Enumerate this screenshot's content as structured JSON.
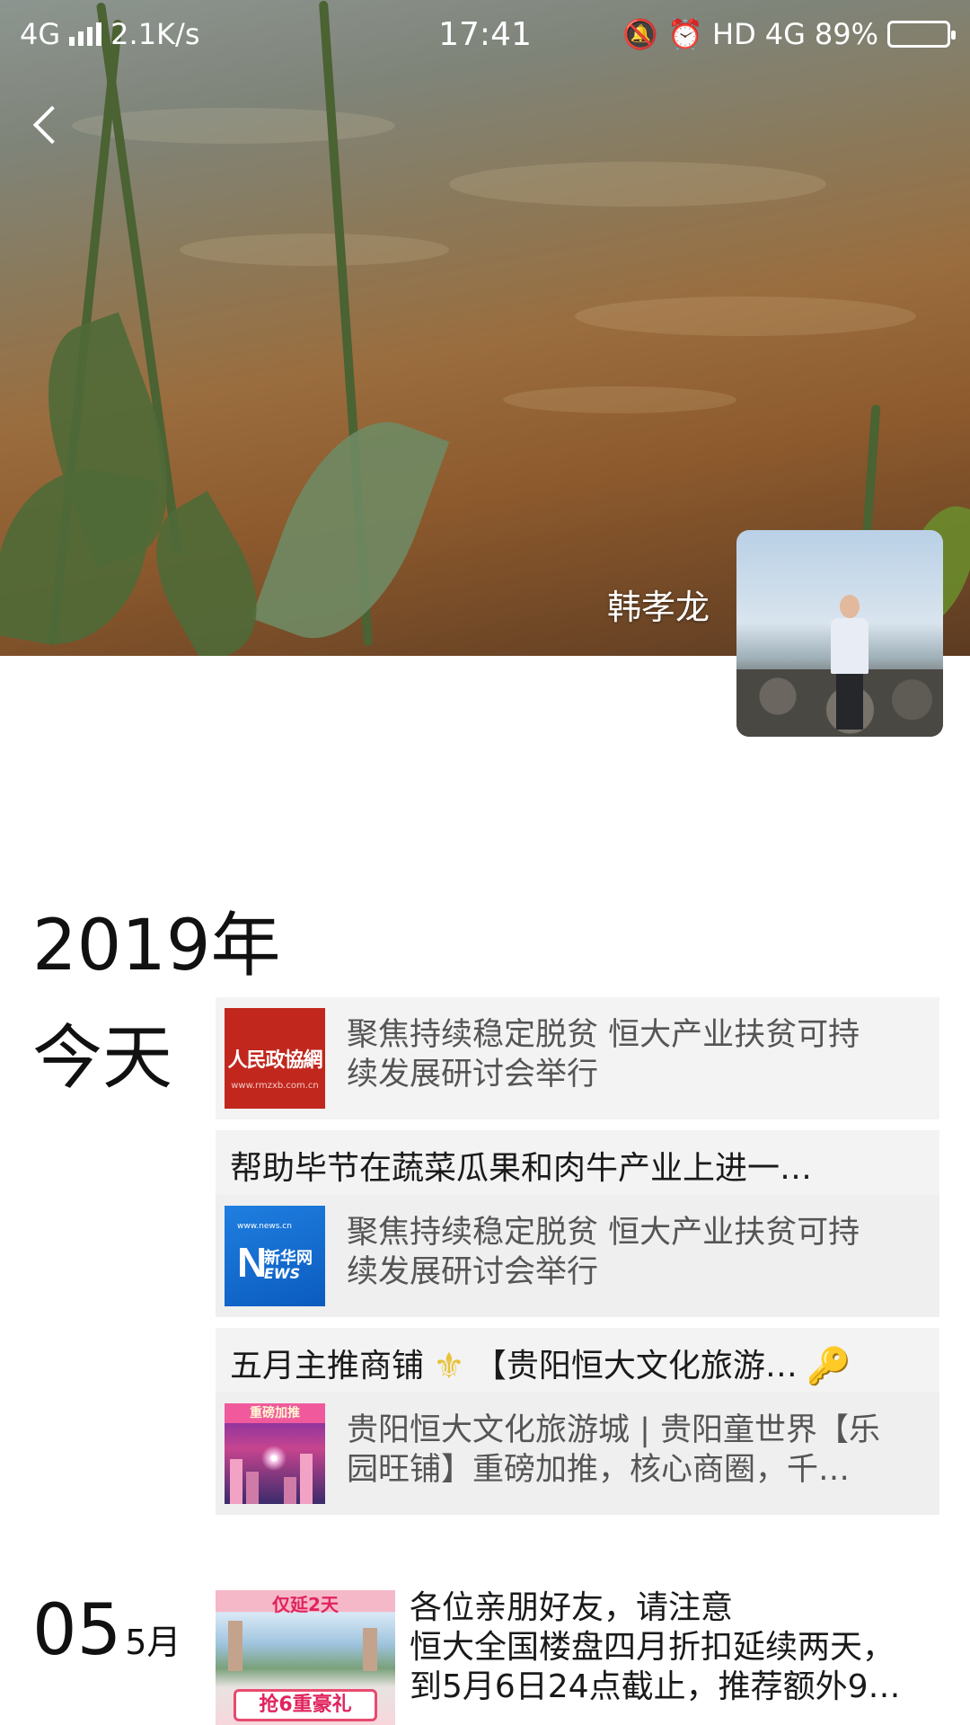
{
  "status_bar": {
    "network": "4G",
    "speed": "2.1K/s",
    "time": "17:41",
    "hd": "HD",
    "network_right": "4G",
    "battery": "89%",
    "battery_level": 0.89
  },
  "profile": {
    "name": "韩孝龙"
  },
  "timeline": {
    "year": "2019年",
    "today_label": "今天",
    "today_posts": [
      {
        "caption": "",
        "thumb": "rmzx",
        "thumb_text": "人民政協網",
        "thumb_url": "www.rmzxb.com.cn",
        "link_title_line1": "聚焦持续稳定脱贫 恒大产业扶贫可持",
        "link_title_line2": "续发展研讨会举行"
      },
      {
        "caption": "帮助毕节在蔬菜瓜果和肉牛产业上进一…",
        "thumb": "news",
        "thumb_url": "www.news.cn",
        "thumb_cn": "新华网",
        "thumb_en": "EWS",
        "thumb_letter": "N",
        "link_title_line1": "聚焦持续稳定脱贫 恒大产业扶贫可持",
        "link_title_line2": "续发展研讨会举行"
      },
      {
        "caption": "五月主推商铺",
        "caption_rest": "【贵阳恒大文化旅游…",
        "caption_icon_left": "fleur-de-lis-icon",
        "caption_icon_right": "key-icon",
        "thumb": "promo",
        "thumb_header": "重磅加推",
        "link_title_line1": "贵阳恒大文化旅游城 | 贵阳童世界【乐",
        "link_title_line2": "园旺铺】重磅加推，核心商圈，千…"
      }
    ],
    "date_post": {
      "day": "05",
      "month": "5月",
      "thumb_top": "仅延2天",
      "thumb_ribbon": "抢6重豪礼",
      "lines": [
        "各位亲朋好友，请注意",
        "恒大全国楼盘四月折扣延续两天，",
        "到5月6日24点截止，推荐额外9…"
      ]
    }
  }
}
